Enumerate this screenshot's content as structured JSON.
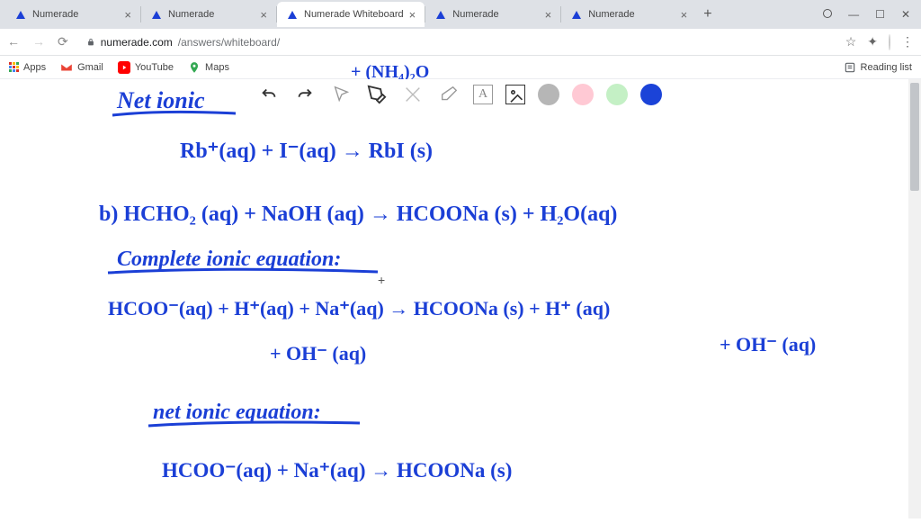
{
  "browser": {
    "tabs": [
      {
        "title": "Numerade",
        "active": false
      },
      {
        "title": "Numerade",
        "active": false
      },
      {
        "title": "Numerade Whiteboard",
        "active": true
      },
      {
        "title": "Numerade",
        "active": false
      },
      {
        "title": "Numerade",
        "active": false
      }
    ],
    "url_host": "numerade.com",
    "url_path": "/answers/whiteboard/",
    "bookmarks": {
      "apps": "Apps",
      "gmail": "Gmail",
      "youtube": "YouTube",
      "maps": "Maps",
      "readinglist": "Reading list"
    }
  },
  "whiteboard": {
    "tools": {
      "undo": "undo",
      "redo": "redo",
      "select": "select",
      "pen": "pen",
      "dual": "dual-pencil",
      "eraser": "eraser",
      "text": "text",
      "image": "image"
    },
    "colors": [
      "gray",
      "pink",
      "green",
      "blue"
    ]
  },
  "handwriting": {
    "net_ionic_title": "Net ionic",
    "eq1": "Rb⁺(aq) + I⁻(aq) → RbI (s)",
    "part_b": "b)  HCHO₂ (aq) + NaOH (aq) → HCOONa (s) +   H₂O(aq)",
    "complete_title": "Complete ionic equation:",
    "complete_line1": "HCOO⁻(aq) + H⁺(aq) + Na⁺(aq)   →  HCOONa (s)  + H⁺ (aq)",
    "complete_line2a": "+ OH⁻ (aq)",
    "complete_line2b": "+ OH⁻ (aq)",
    "net_ionic_title2": "net ionic equation:",
    "eq_final": "HCOO⁻(aq) + Na⁺(aq)  →  HCOONa (s)"
  }
}
